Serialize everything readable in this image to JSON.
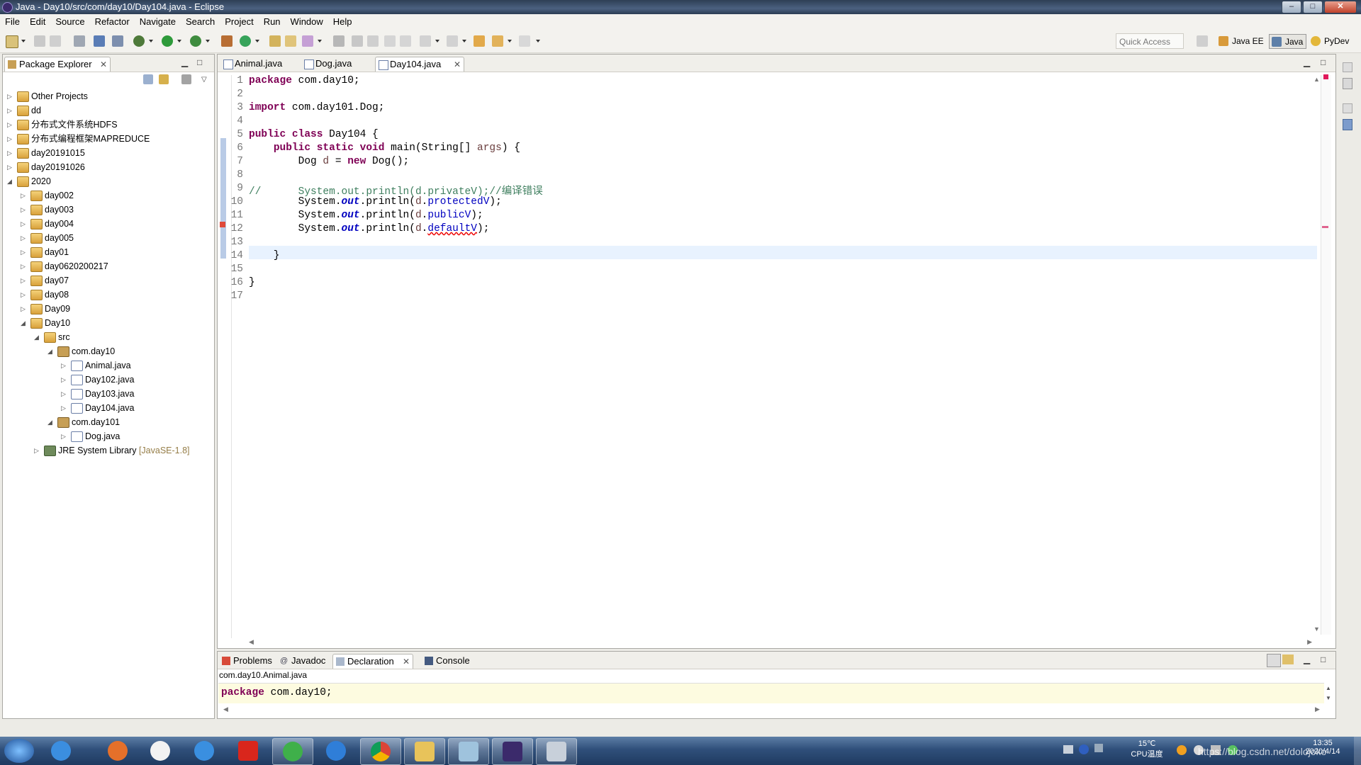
{
  "window": {
    "title": "Java - Day10/src/com/day10/Day104.java - Eclipse",
    "controls": [
      "–",
      "□",
      "✕"
    ]
  },
  "menu": [
    "File",
    "Edit",
    "Source",
    "Refactor",
    "Navigate",
    "Search",
    "Project",
    "Run",
    "Window",
    "Help"
  ],
  "toolbar": {
    "quick_access": "Quick Access",
    "perspectives": [
      "Java EE",
      "Java",
      "PyDev"
    ]
  },
  "explorer": {
    "title": "Package Explorer",
    "items": [
      {
        "label": "Other Projects",
        "depth": 0,
        "arrow": "▷",
        "kind": "proj"
      },
      {
        "label": "dd",
        "depth": 0,
        "arrow": "▷",
        "kind": "proj"
      },
      {
        "label": "分布式文件系统HDFS",
        "depth": 0,
        "arrow": "▷",
        "kind": "proj"
      },
      {
        "label": "分布式编程框架MAPREDUCE",
        "depth": 0,
        "arrow": "▷",
        "kind": "proj"
      },
      {
        "label": "day20191015",
        "depth": 0,
        "arrow": "▷",
        "kind": "proj"
      },
      {
        "label": "day20191026",
        "depth": 0,
        "arrow": "▷",
        "kind": "proj"
      },
      {
        "label": "2020",
        "depth": 0,
        "arrow": "◢",
        "kind": "proj"
      },
      {
        "label": "day002",
        "depth": 1,
        "arrow": "▷",
        "kind": "proj"
      },
      {
        "label": "day003",
        "depth": 1,
        "arrow": "▷",
        "kind": "proj"
      },
      {
        "label": "day004",
        "depth": 1,
        "arrow": "▷",
        "kind": "proj"
      },
      {
        "label": "day005",
        "depth": 1,
        "arrow": "▷",
        "kind": "proj"
      },
      {
        "label": "day01",
        "depth": 1,
        "arrow": "▷",
        "kind": "proj"
      },
      {
        "label": "day0620200217",
        "depth": 1,
        "arrow": "▷",
        "kind": "proj"
      },
      {
        "label": "day07",
        "depth": 1,
        "arrow": "▷",
        "kind": "proj"
      },
      {
        "label": "day08",
        "depth": 1,
        "arrow": "▷",
        "kind": "proj"
      },
      {
        "label": "Day09",
        "depth": 1,
        "arrow": "▷",
        "kind": "proj"
      },
      {
        "label": "Day10",
        "depth": 1,
        "arrow": "◢",
        "kind": "proj"
      },
      {
        "label": "src",
        "depth": 2,
        "arrow": "◢",
        "kind": "srcf"
      },
      {
        "label": "com.day10",
        "depth": 3,
        "arrow": "◢",
        "kind": "pkg"
      },
      {
        "label": "Animal.java",
        "depth": 4,
        "arrow": "▷",
        "kind": "jfile"
      },
      {
        "label": "Day102.java",
        "depth": 4,
        "arrow": "▷",
        "kind": "jfile"
      },
      {
        "label": "Day103.java",
        "depth": 4,
        "arrow": "▷",
        "kind": "jfile"
      },
      {
        "label": "Day104.java",
        "depth": 4,
        "arrow": "▷",
        "kind": "jfile"
      },
      {
        "label": "com.day101",
        "depth": 3,
        "arrow": "◢",
        "kind": "pkg"
      },
      {
        "label": "Dog.java",
        "depth": 4,
        "arrow": "▷",
        "kind": "jfile"
      },
      {
        "label": "JRE System Library",
        "suffix": "[JavaSE-1.8]",
        "depth": 2,
        "arrow": "▷",
        "kind": "lib"
      }
    ]
  },
  "editor": {
    "tabs": [
      "Animal.java",
      "Dog.java",
      "Day104.java"
    ],
    "active_tab": "Day104.java",
    "line_numbers": [
      "1",
      "2",
      "3",
      "4",
      "5",
      "6",
      "7",
      "8",
      "9",
      "10",
      "11",
      "12",
      "13",
      "14",
      "15",
      "16",
      "17"
    ]
  },
  "bottom": {
    "tabs": [
      "Problems",
      "Javadoc",
      "Declaration",
      "Console"
    ],
    "active_tab": "Declaration",
    "path": "com.day10.Animal.java",
    "code_keyword": "package",
    "code_rest": " com.day10;"
  },
  "taskbar": {
    "temp": "15℃",
    "cpu": "CPU温度",
    "time": "13:35",
    "date": "2020/4/14",
    "watermark": "https://blog.csdn.net/dolojoko"
  },
  "colors": {
    "keyword": "#7f0055",
    "field": "#0000c0",
    "comment": "#3f7f5f",
    "current_line": "#e8f2fe"
  }
}
